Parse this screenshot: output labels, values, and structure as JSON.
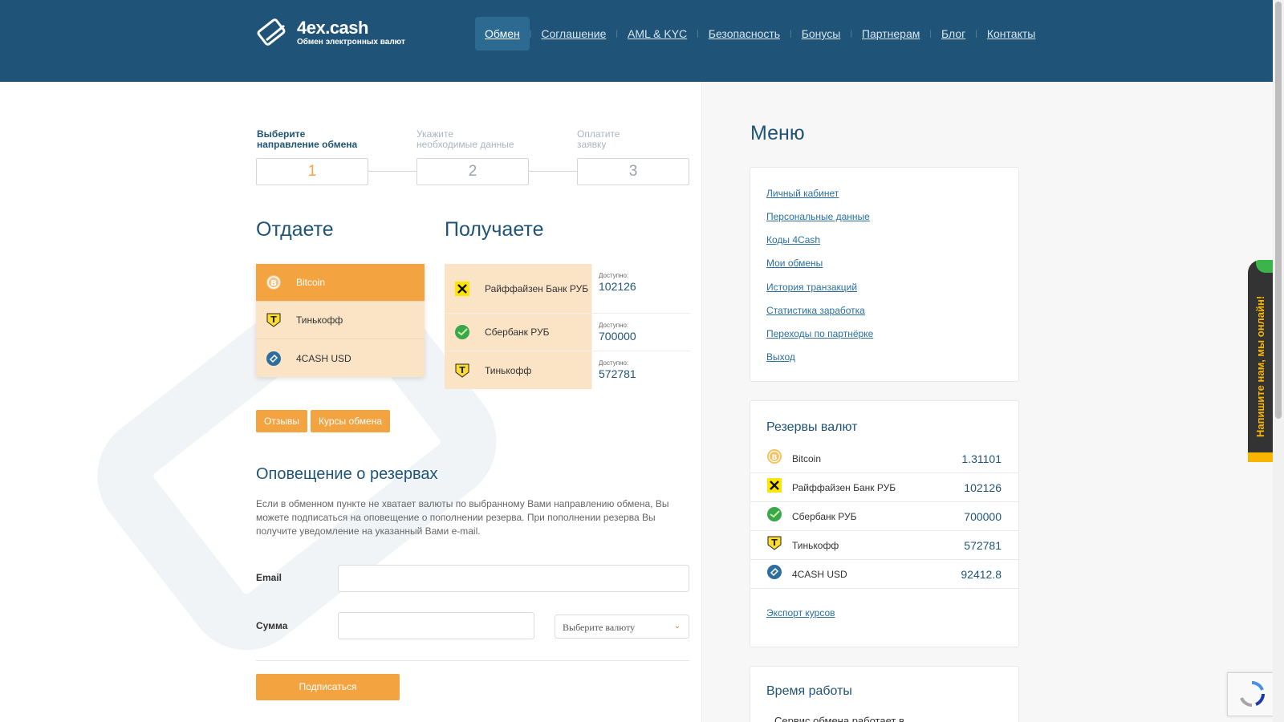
{
  "header": {
    "logo_name": "4ex.cash",
    "logo_tagline": "Обмен электронных валют",
    "nav": [
      {
        "label": "Обмен",
        "active": true
      },
      {
        "label": "Соглашение"
      },
      {
        "label": "AML & KYC"
      },
      {
        "label": "Безопасность"
      },
      {
        "label": "Бонусы"
      },
      {
        "label": "Партнерам"
      },
      {
        "label": "Блог"
      },
      {
        "label": "Контакты"
      }
    ]
  },
  "steps": [
    {
      "title": "Выберите\nнаправление обмена",
      "number": "1"
    },
    {
      "title": "Укажите\nнеобходимые данные",
      "number": "2"
    },
    {
      "title": "Оплатите\nзаявку",
      "number": "3"
    }
  ],
  "give": {
    "heading": "Отдаете",
    "items": [
      {
        "name": "Bitcoin",
        "icon": "bitcoin-icon"
      },
      {
        "name": "Тинькофф",
        "icon": "tinkoff-icon"
      },
      {
        "name": "4CASH USD",
        "icon": "4cash-icon"
      }
    ]
  },
  "get": {
    "heading": "Получаете",
    "available_label": "Доступно:",
    "items": [
      {
        "name": "Райффайзен Банк РУБ",
        "available": "102126",
        "icon": "raiffeisen-icon"
      },
      {
        "name": "Сбербанк РУБ",
        "available": "700000",
        "icon": "sberbank-icon"
      },
      {
        "name": "Тинькофф",
        "available": "572781",
        "icon": "tinkoff-icon"
      }
    ]
  },
  "buttons": {
    "reviews": "Отзывы",
    "rates": "Курсы обмена",
    "subscribe": "Подписаться"
  },
  "alert": {
    "heading": "Оповещение о резервах",
    "text": "Если в обменном пункте не хватает валюты по выбранному Вами направлению обмена, Вы можете подписаться на оповещение о пополнении резерва. При пополнении резерва Вы получите уведомление на указанный Вами e-mail.",
    "email_label": "Email",
    "email_value": "",
    "amount_label": "Сумма",
    "amount_value": "",
    "currency_select": "Выберите валюту"
  },
  "sidebar": {
    "menu_heading": "Меню",
    "menu": [
      "Личный кабинет",
      "Персональные данные",
      "Коды 4Cash",
      "Мои обмены",
      "История транзакций",
      "Статистика заработка",
      "Переходы по партнёрке",
      "Выход"
    ],
    "reserves_heading": "Резервы валют",
    "reserves": [
      {
        "name": "Bitcoin",
        "value": "1.31101",
        "icon": "bitcoin-icon"
      },
      {
        "name": "Райффайзен Банк РУБ",
        "value": "102126",
        "icon": "raiffeisen-icon"
      },
      {
        "name": "Сбербанк РУБ",
        "value": "700000",
        "icon": "sberbank-icon"
      },
      {
        "name": "Тинькофф",
        "value": "572781",
        "icon": "tinkoff-icon"
      },
      {
        "name": "4CASH USD",
        "value": "92412.8",
        "icon": "4cash-icon"
      }
    ],
    "export_link": "Экспорт курсов",
    "hours_heading": "Время работы",
    "hours_text": "Сервис обмена работает в"
  },
  "widget": {
    "online_text": "Напишите нам, мы онлайн!"
  },
  "colors": {
    "header": "#1f5478",
    "accent": "#f3a33f",
    "accent_light": "#fbe3c6",
    "link": "#2a6f9f"
  }
}
